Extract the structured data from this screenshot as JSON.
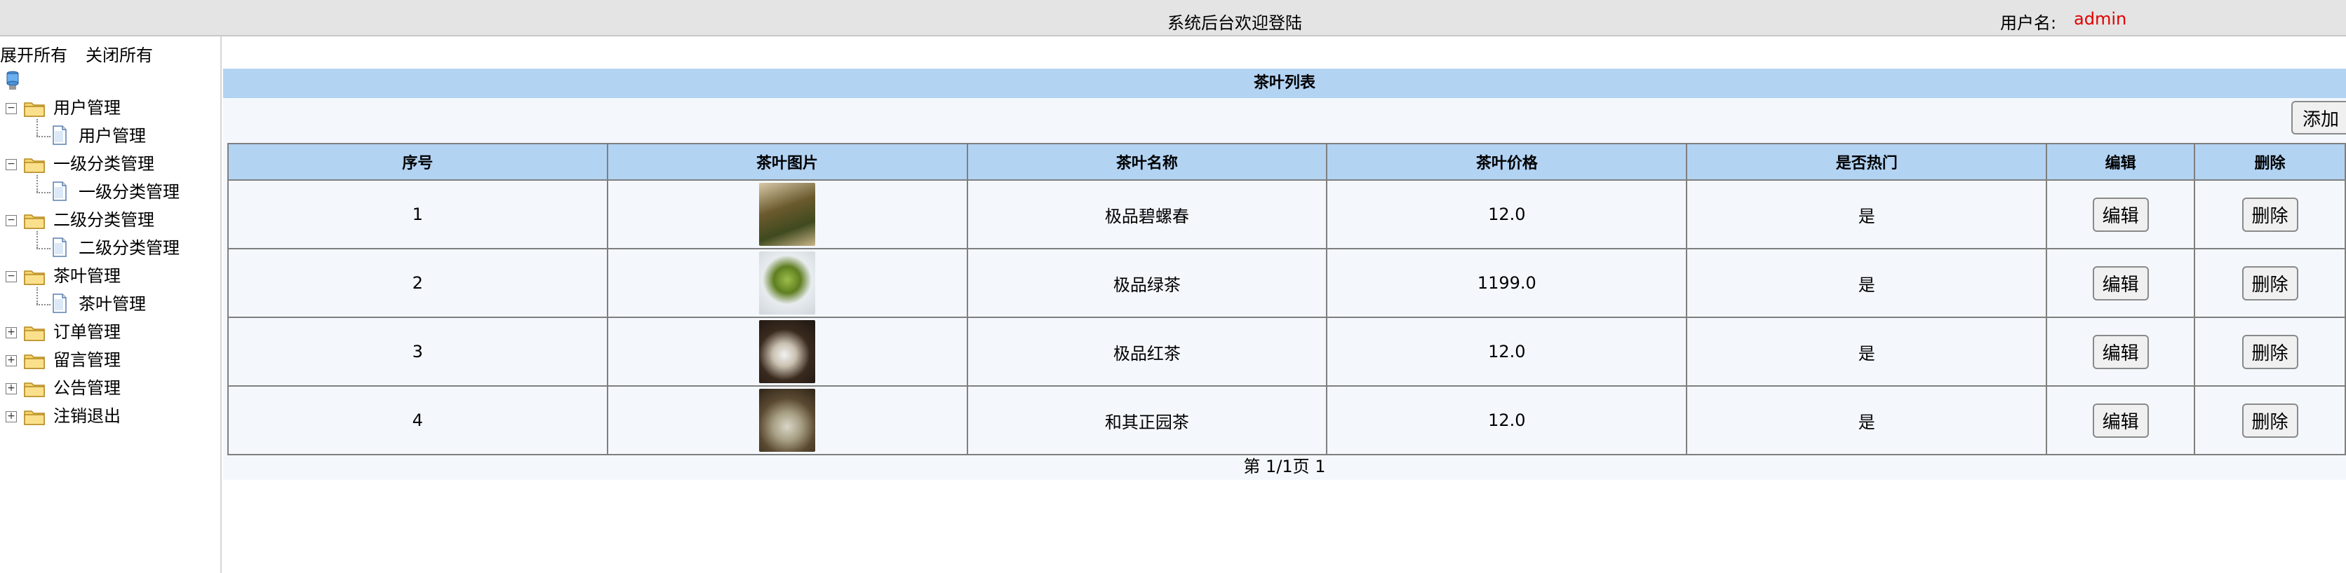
{
  "header": {
    "title": "系统后台欢迎登陆",
    "user_label": "用户名:",
    "username": "admin"
  },
  "sidebar": {
    "expand_all": "展开所有",
    "collapse_all": "关闭所有",
    "groups": [
      {
        "label": "用户管理",
        "expanded": true,
        "child": "用户管理"
      },
      {
        "label": "一级分类管理",
        "expanded": true,
        "child": "一级分类管理"
      },
      {
        "label": "二级分类管理",
        "expanded": true,
        "child": "二级分类管理"
      },
      {
        "label": "茶叶管理",
        "expanded": true,
        "child": "茶叶管理"
      },
      {
        "label": "订单管理",
        "expanded": false
      },
      {
        "label": "留言管理",
        "expanded": false
      },
      {
        "label": "公告管理",
        "expanded": false
      },
      {
        "label": "注销退出",
        "expanded": false
      }
    ]
  },
  "main": {
    "list_title": "茶叶列表",
    "add_label": "添加",
    "columns": [
      "序号",
      "茶叶图片",
      "茶叶名称",
      "茶叶价格",
      "是否热门",
      "编辑",
      "删除"
    ],
    "rows": [
      {
        "index": "1",
        "name": "极品碧螺春",
        "price": "12.0",
        "hot": "是",
        "edit": "编辑",
        "delete": "删除"
      },
      {
        "index": "2",
        "name": "极品绿茶",
        "price": "1199.0",
        "hot": "是",
        "edit": "编辑",
        "delete": "删除"
      },
      {
        "index": "3",
        "name": "极品红茶",
        "price": "12.0",
        "hot": "是",
        "edit": "编辑",
        "delete": "删除"
      },
      {
        "index": "4",
        "name": "和其正园茶",
        "price": "12.0",
        "hot": "是",
        "edit": "编辑",
        "delete": "删除"
      }
    ],
    "pager": "第 1/1页 1"
  }
}
